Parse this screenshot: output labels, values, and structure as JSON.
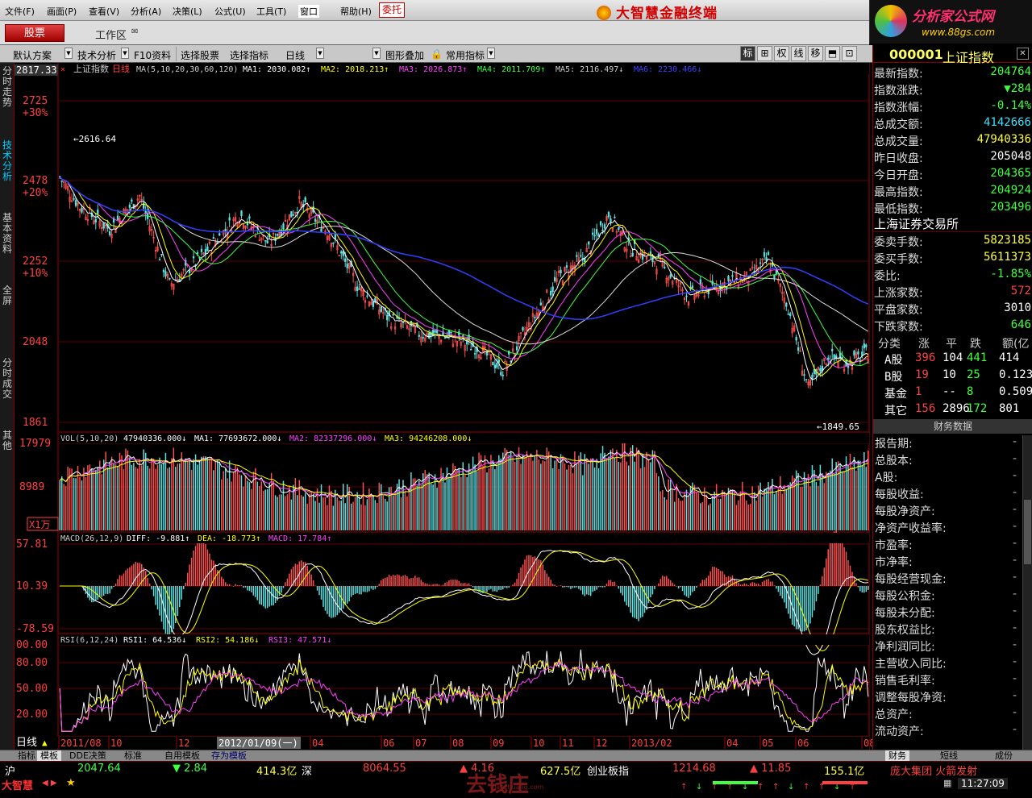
{
  "menu": [
    "文件(F)",
    "画面(P)",
    "查看(V)",
    "分析(A)",
    "决策(L)",
    "公式(U)",
    "工具(T)",
    "窗口",
    "帮助(H)"
  ],
  "weituo": "委托",
  "brand": "大智慧金融终端",
  "site": {
    "name": "分析家公式网",
    "url": "www.88gs.com"
  },
  "toolbar2": {
    "stock_btn": "股票",
    "workarea": "工作区"
  },
  "toolbar3": {
    "items": [
      "默认方案",
      "技术分析",
      "F10资料",
      "选择股票",
      "选择指标",
      "日线",
      "图形叠加",
      "常用指标"
    ],
    "tools": [
      "标",
      "⊞",
      "权",
      "线",
      "移",
      "⬒",
      "⊡"
    ]
  },
  "sidetabs": [
    "分时走势",
    "技术分析",
    "基本资料",
    "全屏",
    "分时成交",
    "其他"
  ],
  "chart": {
    "top_label": "2817.33",
    "title": "上证指数",
    "period": "日线",
    "ma_label": "MA(5,10,20,30,60,120)",
    "ma_values": [
      {
        "t": "MA1: 2030.082↑",
        "c": "#ffffff"
      },
      {
        "t": "MA2: 2018.213↑",
        "c": "#ffff00"
      },
      {
        "t": "MA3: 2026.873↑",
        "c": "#ff40ff"
      },
      {
        "t": "MA4: 2011.709↑",
        "c": "#40ff40"
      },
      {
        "t": "MA5: 2116.497↓",
        "c": "#cccccc"
      },
      {
        "t": "MA6: 2230.466↓",
        "c": "#4040ff"
      }
    ],
    "price_axis": [
      {
        "v": "2725",
        "p": "+30%"
      },
      {
        "v": "2478",
        "p": "+20%"
      },
      {
        "v": "2252",
        "p": "+10%"
      },
      {
        "v": "2048",
        "p": ""
      },
      {
        "v": "1861",
        "p": ""
      }
    ],
    "high_mark": "2616.64",
    "low_mark": "1849.65",
    "vol_title": "VOL(5,10,20)",
    "vol_value": "47940336.000↓",
    "vol_ma": [
      {
        "t": "MA1: 77693672.000↓",
        "c": "#ffffff"
      },
      {
        "t": "MA2: 82337296.000↓",
        "c": "#ff40ff"
      },
      {
        "t": "MA3: 94246208.000↓",
        "c": "#ffff00"
      }
    ],
    "vol_axis": [
      "17979",
      "8989"
    ],
    "vol_unit": "X1万",
    "macd_title": "MACD(26,12,9)",
    "macd_vals": [
      {
        "t": "DIFF: -9.881↑",
        "c": "#ffffff"
      },
      {
        "t": "DEA: -18.773↑",
        "c": "#ffff00"
      },
      {
        "t": "MACD: 17.784↑",
        "c": "#ff40ff"
      }
    ],
    "macd_axis": [
      "57.81",
      "10.39",
      "-78.59"
    ],
    "rsi_title": "RSI(6,12,24)",
    "rsi_vals": [
      {
        "t": "RSI1: 64.536↓",
        "c": "#ffffff"
      },
      {
        "t": "RSI2: 54.186↓",
        "c": "#ffff00"
      },
      {
        "t": "RSI3: 47.571↓",
        "c": "#ff40ff"
      }
    ],
    "rsi_axis": [
      "00.00",
      "80.00",
      "50.00",
      "20.00"
    ],
    "period_label": "日线",
    "date_axis": [
      "2011/08",
      "10",
      "12",
      "2012/01/09(一)",
      "04",
      "06",
      "07",
      "08",
      "09",
      "10",
      "11",
      "12",
      "2013/02",
      "04",
      "05",
      "06",
      "08"
    ]
  },
  "right": {
    "code": "000001",
    "name": "上证指数",
    "rows1": [
      {
        "l": "最新指数:",
        "v": "204764",
        "c": "#40ff40"
      },
      {
        "l": "指数涨跌:",
        "v": "▼284",
        "c": "#40ff40"
      },
      {
        "l": "指数涨幅:",
        "v": "-0.14%",
        "c": "#40ff40"
      },
      {
        "l": "总成交额:",
        "v": "4142666",
        "c": "#40e0ff"
      },
      {
        "l": "总成交量:",
        "v": "47940336",
        "c": "#ffff40"
      },
      {
        "l": "昨日收盘:",
        "v": "205048",
        "c": "#ffffff"
      },
      {
        "l": "今日开盘:",
        "v": "204365",
        "c": "#40ff40"
      },
      {
        "l": "最高指数:",
        "v": "204924",
        "c": "#40ff40"
      },
      {
        "l": "最低指数:",
        "v": "203496",
        "c": "#40ff40"
      }
    ],
    "exchange": "上海证券交易所",
    "rows2": [
      {
        "l": "委卖手数:",
        "v": "5823185",
        "c": "#ffff40"
      },
      {
        "l": "委买手数:",
        "v": "5611373",
        "c": "#ffff40"
      },
      {
        "l": "委比:",
        "v": "-1.85%",
        "c": "#40ff40"
      },
      {
        "l": "上涨家数:",
        "v": "572",
        "c": "#ff4040"
      },
      {
        "l": "平盘家数:",
        "v": "3010",
        "c": "#ffffff"
      },
      {
        "l": "下跌家数:",
        "v": "646",
        "c": "#40ff40"
      }
    ],
    "table_head": [
      "分类",
      "涨",
      "平",
      "跌",
      "额(亿"
    ],
    "table": [
      [
        "A股",
        "396",
        "104",
        "441",
        "414"
      ],
      [
        "B股",
        "19",
        "10",
        "25",
        "0.123"
      ],
      [
        "基金",
        "1",
        "--",
        "8",
        "0.509"
      ],
      [
        "其它",
        "156",
        "2896",
        "172",
        "801"
      ]
    ],
    "fin_title": "财务数据",
    "fin": [
      "报告期:",
      "总股本:",
      "A股:",
      "每股收益:",
      "每股净资产:",
      "净资产收益率:",
      "市盈率:",
      "市净率:",
      "每股经营现金:",
      "每股公积金:",
      "每股未分配:",
      "股东权益比:",
      "净利润同比:",
      "主营收入同比:",
      "销售毛利率:",
      "调整每股净资:",
      "总资产:",
      "流动资产:"
    ],
    "fin_dash": "-",
    "bottom_tabs": [
      "财务",
      "短线",
      "成份"
    ]
  },
  "bottom_tabs": [
    "指标",
    "模板",
    "DDE决策",
    "标准",
    "自用模板",
    "存为模板"
  ],
  "status": {
    "logo": "大智慧",
    "sh_label": "沪",
    "sh_val": "2047.64",
    "sh_chg": "▼ 2.84",
    "sh_amt": "414.3亿",
    "sz_label": "深",
    "sz_val": "8064.55",
    "sz_chg": "▲ 4.16",
    "sz_amt": "627.5亿",
    "cy_label": "创业板指",
    "cy_val": "1214.68",
    "cy_chg": "▲ 11.85",
    "cy_amt": "155.1亿",
    "news": "庞大集团 火箭发射",
    "time": "11:27:09",
    "watermark": "去钱庄",
    "watermark_url": "qianzhuang.com"
  }
}
